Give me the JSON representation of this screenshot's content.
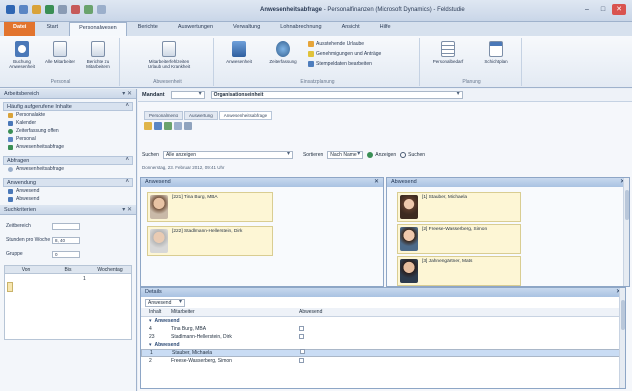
{
  "window": {
    "title_bold": "Anwesenheitsabfrage",
    "title_rest": " - Personalfinanzen (Microsoft Dynamics) - Feldstudie",
    "buttons": [
      "–",
      "□",
      "✕"
    ]
  },
  "ribbon": {
    "tabs": [
      "Datei",
      "Start",
      "Personalwesen",
      "Berichte",
      "Auswertungen",
      "Verwaltung",
      "Lohnabrechnung",
      "Ansicht",
      "Hilfe"
    ],
    "active_tab": "Personalwesen",
    "groups": [
      {
        "label": "Personal",
        "buttons": [
          "Buchung Anwesenheit",
          "Alle Mitarbeiter",
          "Berichte zu Mitarbeitern"
        ]
      },
      {
        "label": "Abwesenheit",
        "buttons": [
          "Mitarbeiterfehlzeiten",
          "Urlaub und Krankheit"
        ]
      },
      {
        "label": "Einsatzplanung",
        "buttons": [
          "Anwesenheit",
          "Zeiterfassung"
        ],
        "small": [
          "Ausstehende Urlaube",
          "Genehmigungen und Anträge",
          "Stempeldaten bearbeiten"
        ]
      },
      {
        "label": "Planung",
        "buttons": [
          "Personalbedarf",
          "Schichtplan"
        ]
      }
    ]
  },
  "left_panel": {
    "title": "Arbeitsbereich",
    "sections": [
      {
        "title": "Häufig aufgerufene Inhalte",
        "items": [
          "Personalakte",
          "Kalender",
          "Zeiterfassung offen",
          "Personal",
          "Anwesenheitsabfrage"
        ]
      },
      {
        "title": "Abfragen",
        "items": [
          "Anwesenheitsabfrage"
        ]
      },
      {
        "title": "Anwendung",
        "items": [
          "Anwesend",
          "Abwesend"
        ]
      }
    ],
    "filter_title": "Suchkriterien",
    "filters": [
      {
        "label": "Zeitbereich",
        "value": ""
      },
      {
        "label": "Stunden pro Woche",
        "value": "8, 40"
      },
      {
        "label": "Gruppe",
        "value": "0"
      }
    ],
    "grid_columns": [
      "Von",
      "Bis",
      "Wochentag"
    ],
    "grid_first_value": "1"
  },
  "main": {
    "filter_label": "Mandant",
    "filter_value": "",
    "filter2_value": "Organisationseinheit",
    "doc_tabs": [
      "Personalmenü",
      "Auswertung",
      "Anwesenheitsabfrage"
    ],
    "search_label": "Suchen",
    "search_value": "Alle anzeigen",
    "sort_label": "Sortieren",
    "sort_value": "Nach Name",
    "button_anzeigen": "Anzeigen",
    "button_suchen": "Suchen",
    "info_text": "Donnerstag, 23. Februar 2012, 09:41 Uhr",
    "panel_left_title": "Anwesend",
    "panel_right_title": "Abwesend",
    "present_cards": [
      "[221] Tina Burg, MBA",
      "[222] Stadlmann-Hellerstein, Dirk"
    ],
    "absent_cards": [
      "[1] Stauber, Michaela",
      "[2] Freese-Wasserberg, Simon",
      "[3] Jahnengärtner, Mats"
    ],
    "list_title": "Details",
    "list_filter": "Anwesend",
    "list_columns": [
      "Inhalt",
      "Mitarbeiter",
      "Abwesend"
    ],
    "list_rows": [
      {
        "type": "group",
        "text": "Anwesend"
      },
      {
        "type": "row",
        "c1": "4",
        "c2": "Tina Burg, MBA"
      },
      {
        "type": "row",
        "c1": "23",
        "c2": "Stadlmann-Hellerstein, Dirk"
      },
      {
        "type": "group",
        "text": "Abwesend"
      },
      {
        "type": "row-selected",
        "c1": "1",
        "c2": "Stauber, Michaela"
      },
      {
        "type": "row",
        "c1": "2",
        "c2": "Freese-Wasserberg, Simon"
      }
    ]
  }
}
